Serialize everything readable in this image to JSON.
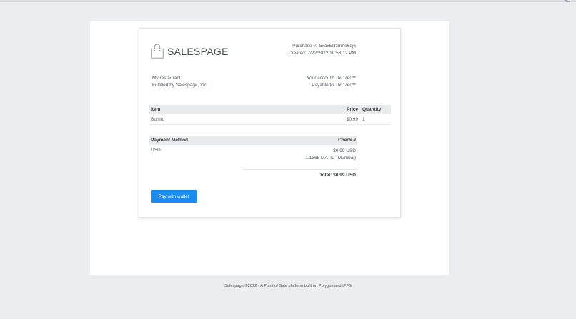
{
  "brand": {
    "name": "SALESPAGE"
  },
  "purchase": {
    "number_text": "Purchase #: l5xax5srzmne6dj6",
    "created_text": "Created: 7/22/2022 10:58:12 PM"
  },
  "merchant": {
    "name": "My restaurant",
    "fulfilled_by": "Fulfilled by Salespage, Inc."
  },
  "account": {
    "your_account": "Your account: 0xD7e0**",
    "payable_to": "Payable to: 0xD7e0**"
  },
  "items_table": {
    "headers": {
      "item": "Item",
      "price": "Price",
      "quantity": "Quantity"
    },
    "rows": [
      {
        "item": "Burrito",
        "price": "$0.99",
        "quantity": "1"
      }
    ]
  },
  "payment_table": {
    "headers": {
      "method": "Payment Method",
      "check": "Check #"
    },
    "method": "USD",
    "amount_usd": "$0.99 USD",
    "amount_matic": "1.1365 MATIC (Mumbai)",
    "total": "Total: $0.99 USD"
  },
  "actions": {
    "pay_label": "Pay with wallet"
  },
  "footer": {
    "text": "Salespage ©2022 - A Point of Sale platform built on Polygon and IPFS"
  },
  "colors": {
    "background": "#ecedf0",
    "panel": "#ffffff",
    "button": "#1a8cf0",
    "table_header": "#e9eaec"
  }
}
